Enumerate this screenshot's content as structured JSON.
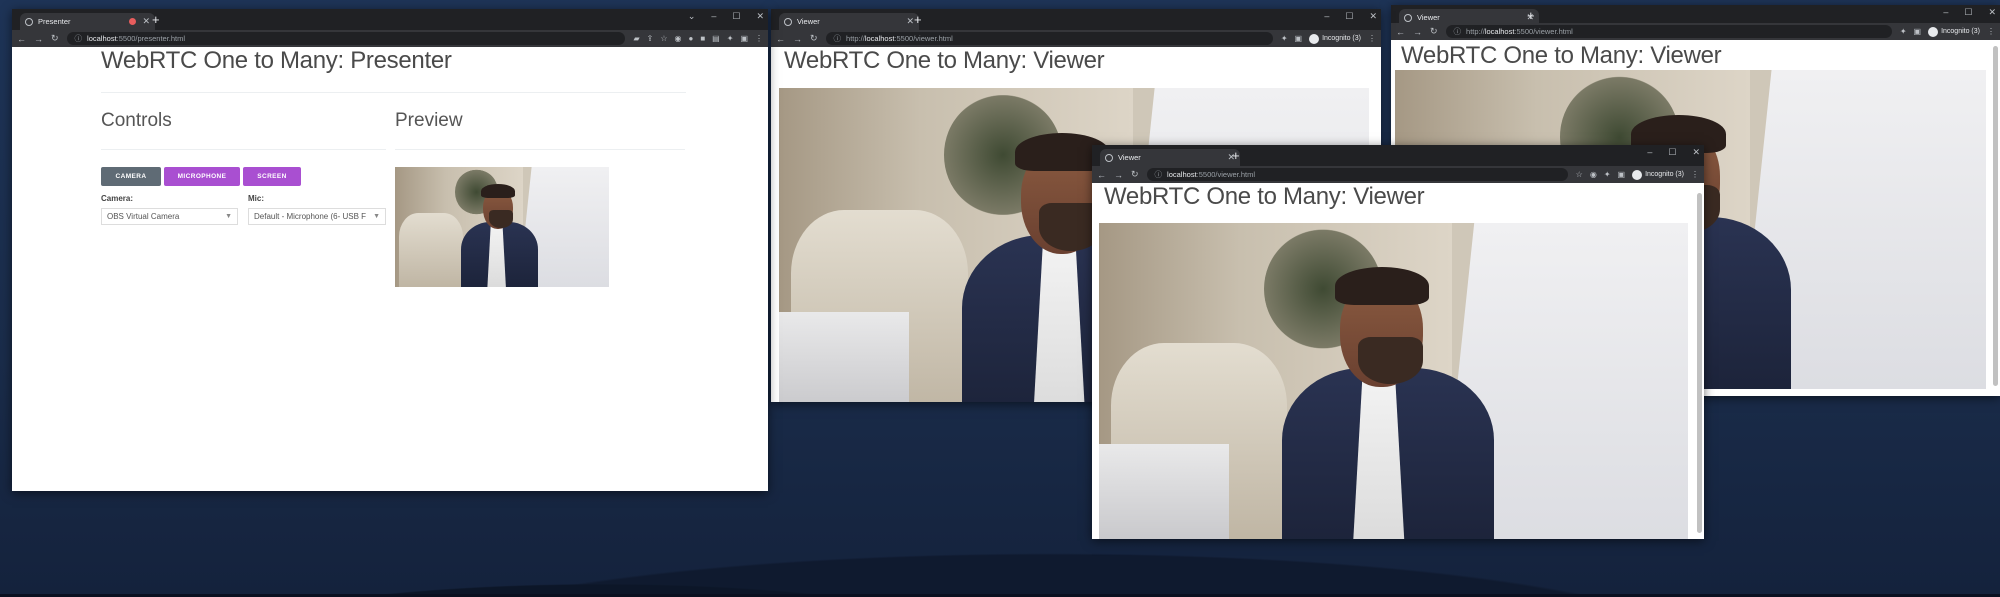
{
  "presenter": {
    "tab_title": "Presenter",
    "url_host": "localhost",
    "url_rest": ":5500/presenter.html",
    "page_title": "WebRTC One to Many: Presenter",
    "controls_title": "Controls",
    "preview_title": "Preview",
    "buttons": {
      "camera": "CAMERA",
      "microphone": "MICROPHONE",
      "screen": "SCREEN"
    },
    "camera_label": "Camera:",
    "camera_value": "OBS Virtual Camera",
    "mic_label": "Mic:",
    "mic_value": "Default - Microphone (6- USB F"
  },
  "viewer1": {
    "tab_title": "Viewer",
    "url_prefix": "http://",
    "url_host": "localhost",
    "url_rest": ":5500/viewer.html",
    "page_title": "WebRTC One to Many: Viewer",
    "incognito": "Incognito (3)"
  },
  "viewer2": {
    "tab_title": "Viewer",
    "url_prefix": "http://",
    "url_host": "localhost",
    "url_rest": ":5500/viewer.html",
    "page_title": "WebRTC One to Many: Viewer",
    "incognito": "Incognito (3)"
  },
  "viewer3": {
    "tab_title": "Viewer",
    "url_host": "localhost",
    "url_rest": ":5500/viewer.html",
    "page_title": "WebRTC One to Many: Viewer",
    "incognito": "Incognito (3)"
  },
  "colors": {
    "camera_button": "#5f6b75",
    "accent_button": "#a94fd1",
    "desktop": "#1e3457",
    "chrome_dark": "#202124"
  },
  "icons": [
    "globe-icon",
    "close-icon",
    "plus-icon",
    "minimize-icon",
    "maximize-icon",
    "back-icon",
    "forward-icon",
    "reload-icon",
    "info-icon",
    "star-icon",
    "extensions-icon",
    "sidebar-icon",
    "more-icon",
    "incognito-icon",
    "recording-icon",
    "chevron-down-icon"
  ]
}
